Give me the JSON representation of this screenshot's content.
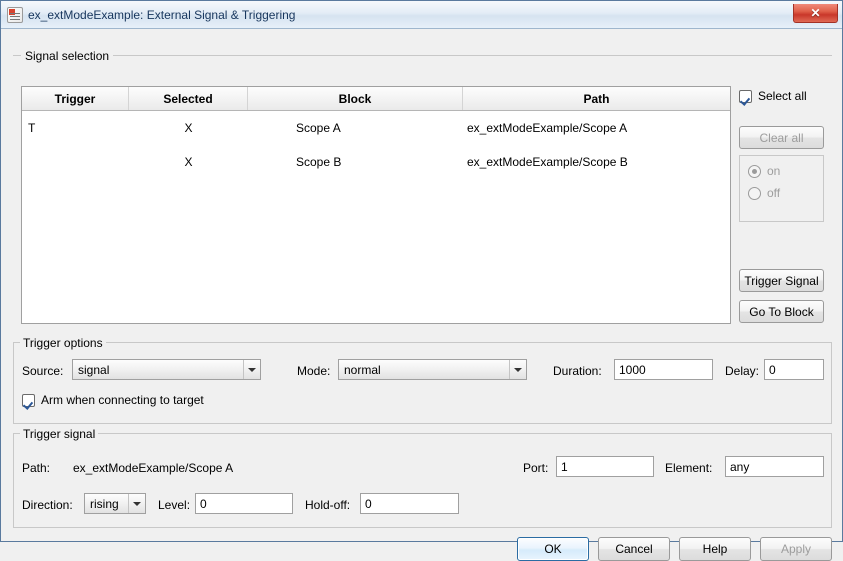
{
  "window": {
    "title": "ex_extModeExample: External Signal & Triggering",
    "icon": "matlab-figure-icon",
    "close_label": "✕"
  },
  "signal_selection": {
    "legend": "Signal selection",
    "columns": [
      "Trigger",
      "Selected",
      "Block",
      "Path"
    ],
    "rows": [
      {
        "trigger": "T",
        "selected": "X",
        "block": "Scope A",
        "path": "ex_extModeExample/Scope A"
      },
      {
        "trigger": "",
        "selected": "X",
        "block": "Scope B",
        "path": "ex_extModeExample/Scope B"
      }
    ],
    "select_all_label": "Select all",
    "select_all_checked": true,
    "clear_all_label": "Clear all",
    "radio_on_label": "on",
    "radio_off_label": "off",
    "radio_selected": "on",
    "trigger_signal_button": "Trigger Signal",
    "go_to_block_button": "Go To Block"
  },
  "trigger_options": {
    "legend": "Trigger options",
    "source_label": "Source:",
    "source_value": "signal",
    "mode_label": "Mode:",
    "mode_value": "normal",
    "duration_label": "Duration:",
    "duration_value": "1000",
    "delay_label": "Delay:",
    "delay_value": "0",
    "arm_label": "Arm when connecting to target",
    "arm_checked": true
  },
  "trigger_signal": {
    "legend": "Trigger signal",
    "path_label": "Path:",
    "path_value": "ex_extModeExample/Scope A",
    "port_label": "Port:",
    "port_value": "1",
    "element_label": "Element:",
    "element_value": "any",
    "direction_label": "Direction:",
    "direction_value": "rising",
    "level_label": "Level:",
    "level_value": "0",
    "holdoff_label": "Hold-off:",
    "holdoff_value": "0"
  },
  "footer": {
    "ok": "OK",
    "cancel": "Cancel",
    "help": "Help",
    "apply": "Apply"
  },
  "colors": {
    "accent": "#2b6ca3",
    "title_text": "#17365d",
    "close_red": "#c9372a",
    "disabled_text": "#9d9d9d"
  }
}
